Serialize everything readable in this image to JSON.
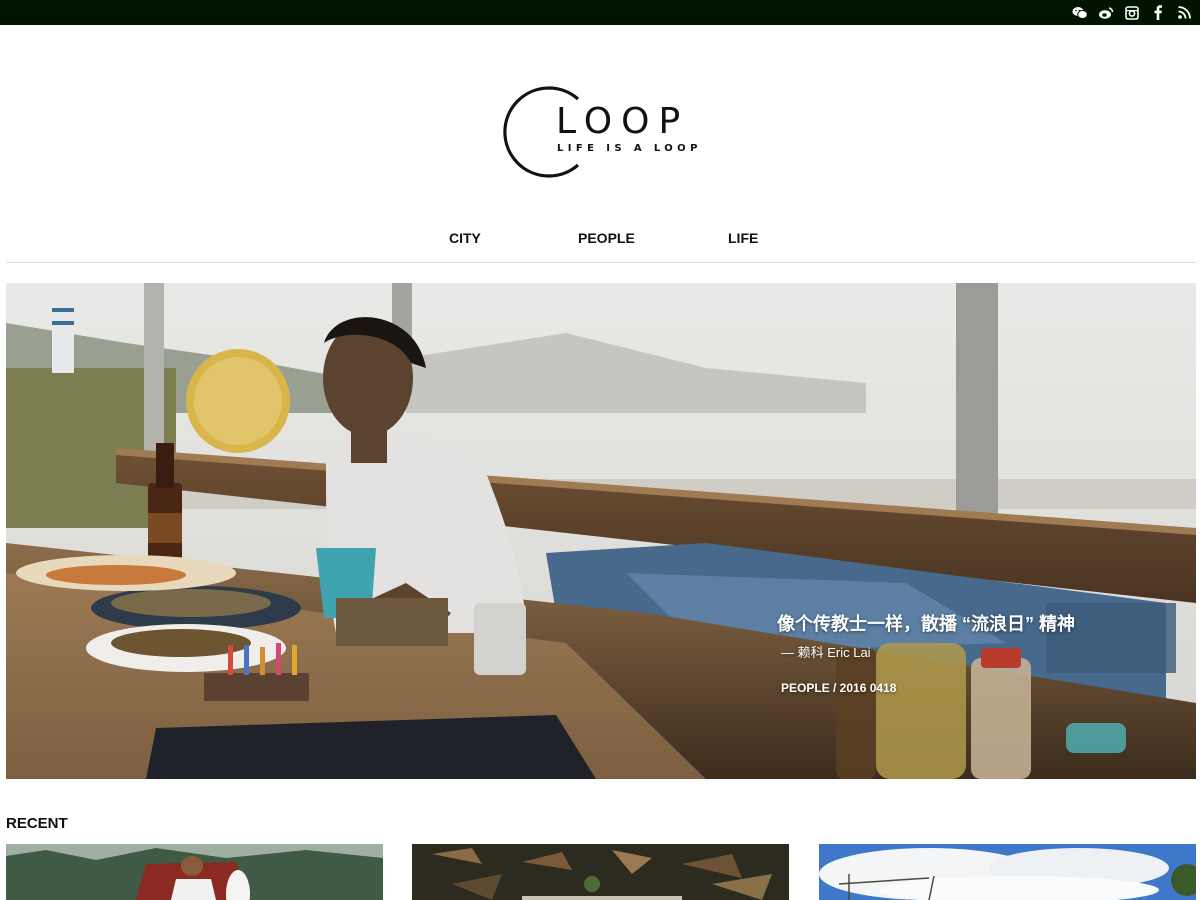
{
  "social": {
    "items": [
      {
        "name": "wechat-icon"
      },
      {
        "name": "weibo-icon"
      },
      {
        "name": "instagram-icon"
      },
      {
        "name": "facebook-icon"
      },
      {
        "name": "rss-icon"
      }
    ]
  },
  "logo": {
    "wordmark": "LOOP",
    "tagline": "LIFE IS A LOOP"
  },
  "nav": {
    "city": "CITY",
    "people": "PEOPLE",
    "life": "LIFE"
  },
  "hero": {
    "title": "像个传教士一样，散播 “流浪日” 精神",
    "author": "— 赖科 Eric Lai",
    "meta": "PEOPLE / 2016 0418"
  },
  "recent": {
    "heading": "RECENT"
  },
  "colors": {
    "topbar": "#001400",
    "text": "#111111",
    "rule": "#dcdcdc"
  }
}
